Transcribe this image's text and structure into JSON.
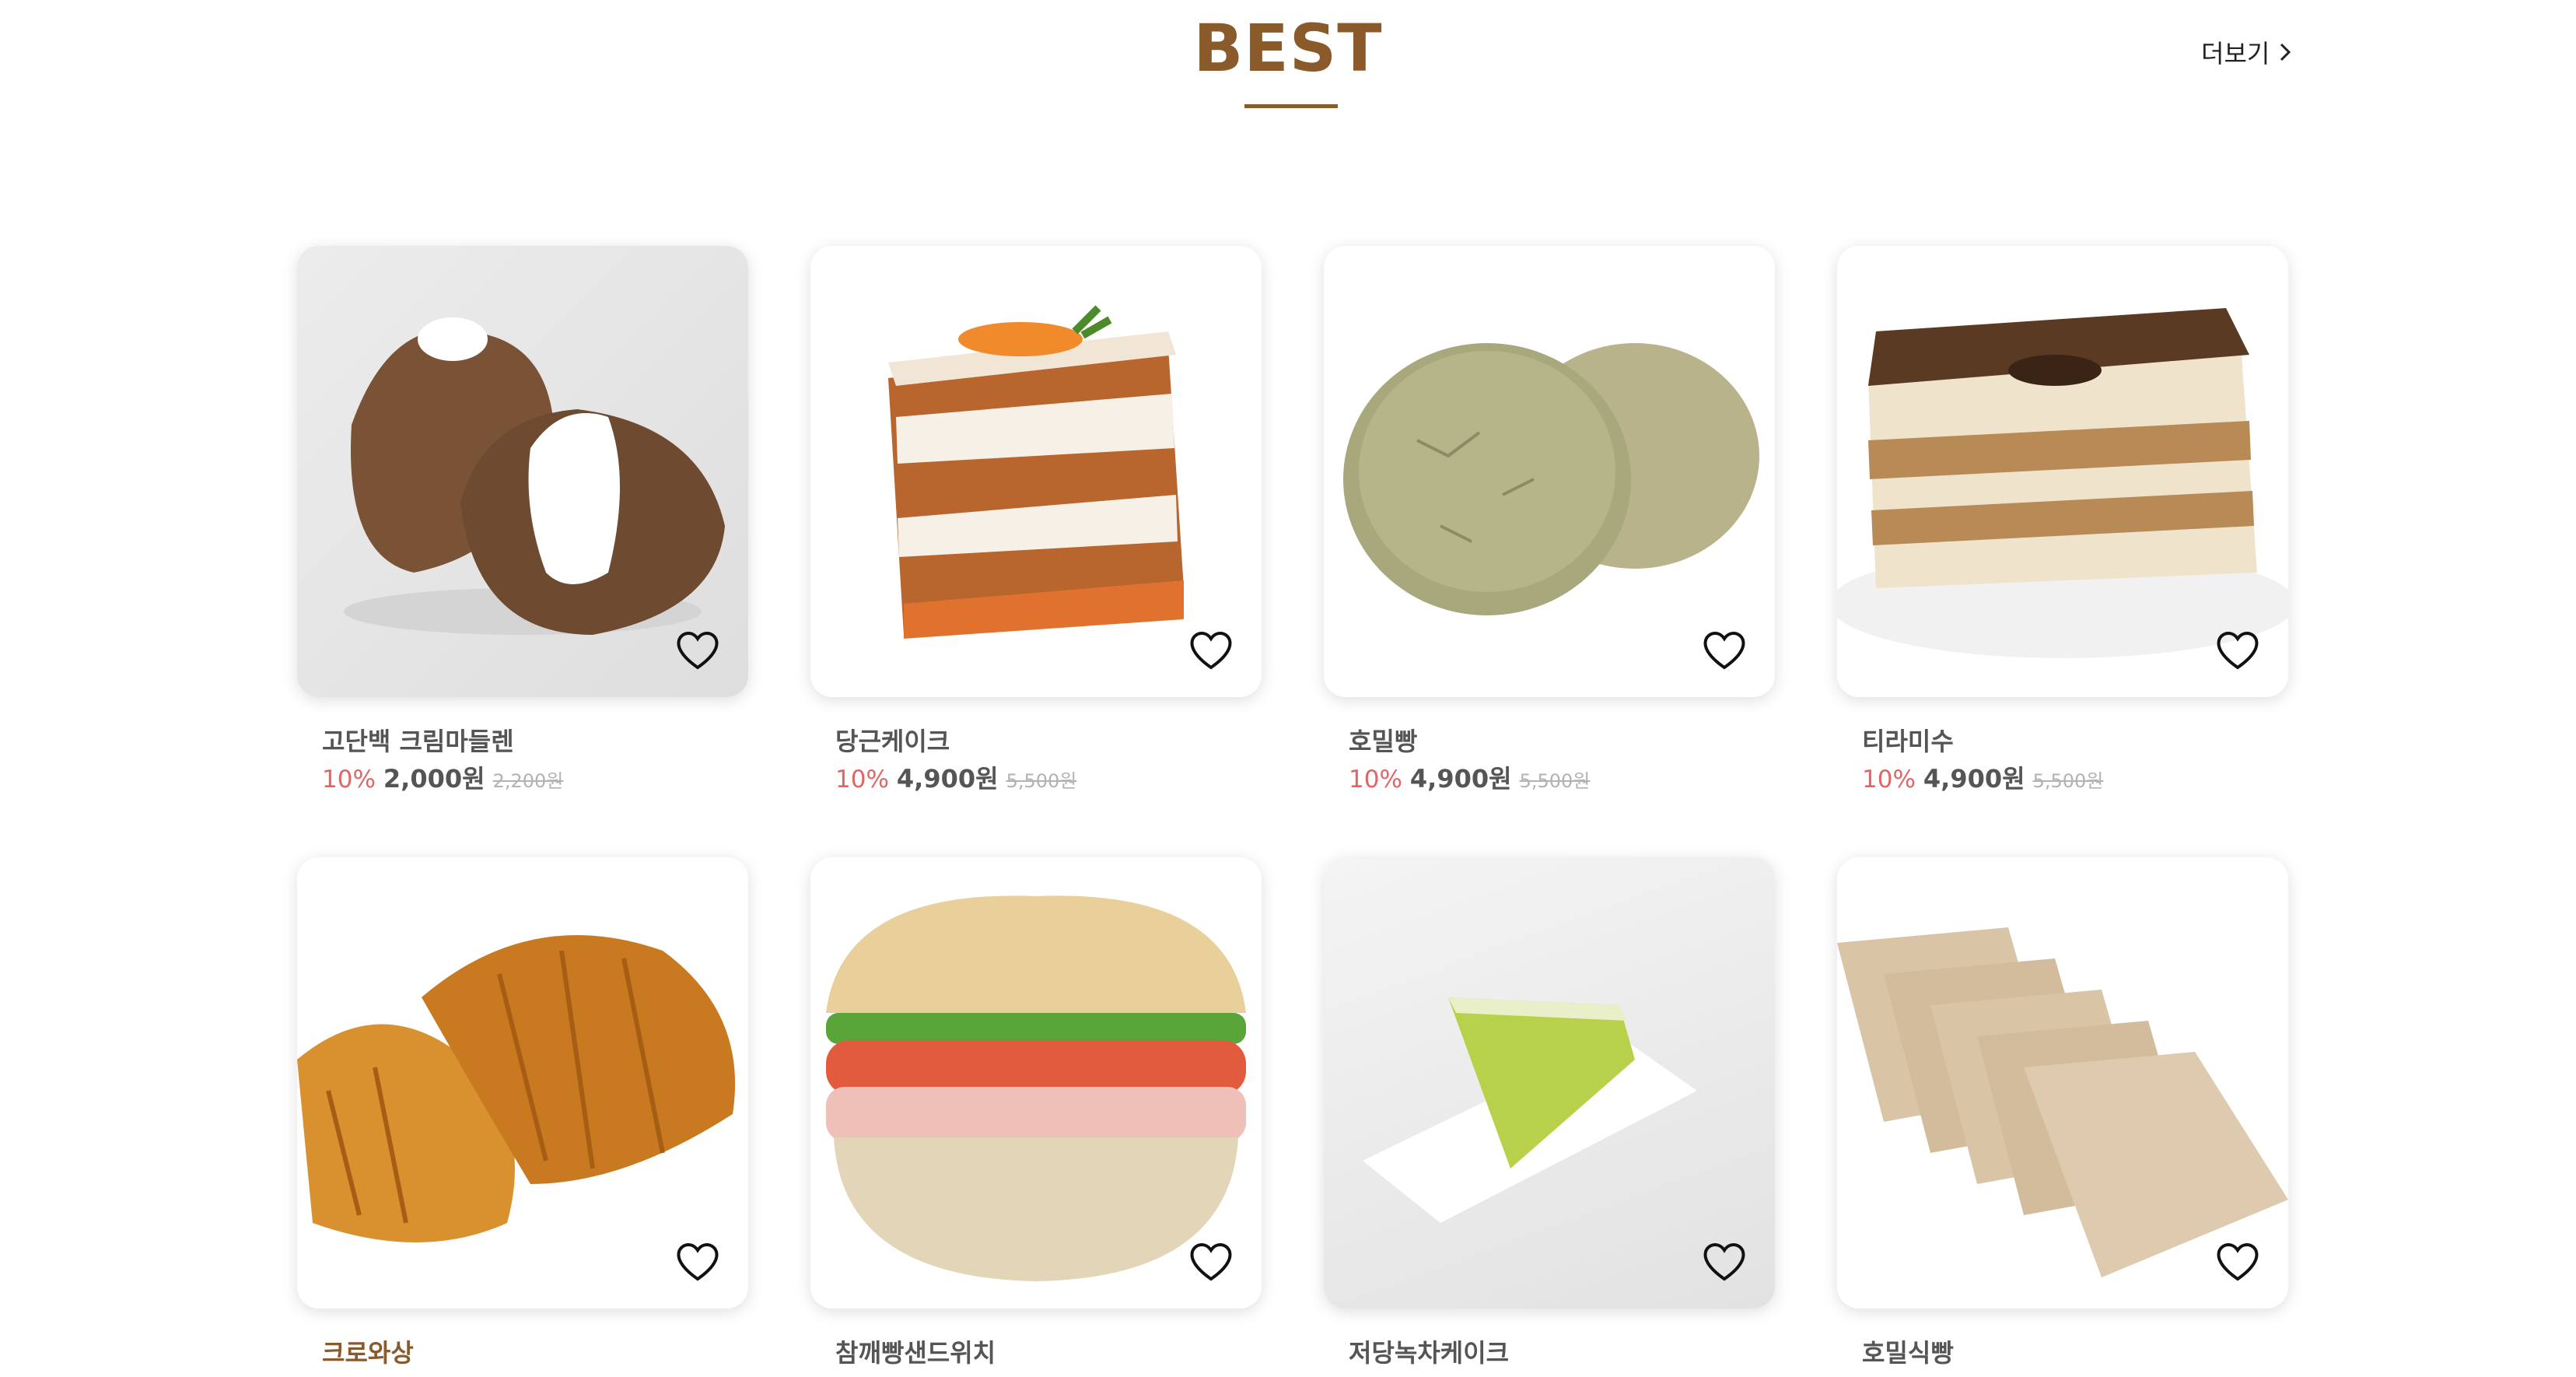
{
  "section": {
    "title": "BEST",
    "more_label": "더보기",
    "more_icon": "chevron-right-icon"
  },
  "colors": {
    "accent": "#8b5a2b",
    "discount": "#e26565",
    "text": "#555555",
    "original_price": "#b3b3b3"
  },
  "products": [
    {
      "name": "고단백 크림마들렌",
      "discount": "10%",
      "price": "2,000원",
      "original_price": "2,200원"
    },
    {
      "name": "당근케이크",
      "discount": "10%",
      "price": "4,900원",
      "original_price": "5,500원"
    },
    {
      "name": "호밀빵",
      "discount": "10%",
      "price": "4,900원",
      "original_price": "5,500원"
    },
    {
      "name": "티라미수",
      "discount": "10%",
      "price": "4,900원",
      "original_price": "5,500원"
    },
    {
      "name": "크로와상"
    },
    {
      "name": "참깨빵샌드위치"
    },
    {
      "name": "저당녹차케이크"
    },
    {
      "name": "호밀식빵"
    }
  ]
}
